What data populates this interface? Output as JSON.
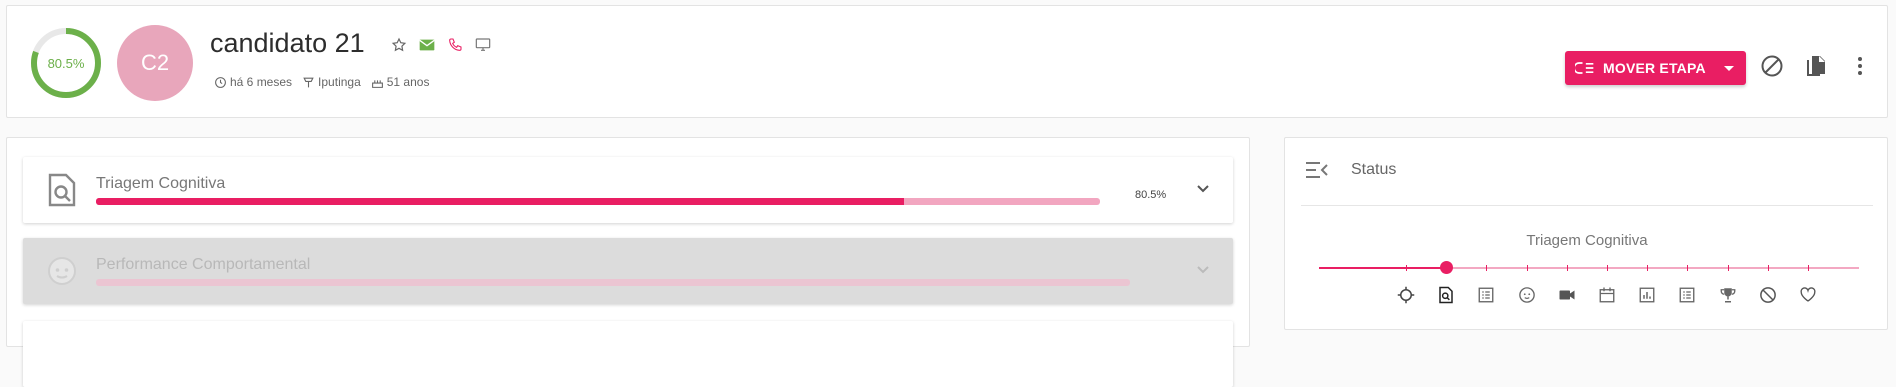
{
  "candidate": {
    "score": 80.5,
    "score_label": "80.5%",
    "initials": "C2",
    "name": "candidato 21",
    "meta": {
      "time": "há 6 meses",
      "location": "Iputinga",
      "age": "51 anos"
    }
  },
  "header": {
    "move_button_label": "MOVER ETAPA"
  },
  "stages": [
    {
      "title": "Triagem Cognitiva",
      "progress": 0.805,
      "pct_label": "80.5%"
    },
    {
      "title": "Performance Comportamental",
      "progress": 0
    }
  ],
  "status": {
    "title": "Status",
    "current_stage": "Triagem Cognitiva",
    "timeline_icons": [
      "target-icon",
      "search-document-icon",
      "list-icon",
      "face-icon",
      "video-icon",
      "calendar-icon",
      "chart-icon",
      "list-icon",
      "trophy-icon",
      "block-icon",
      "heart-icon"
    ],
    "current_index": 1
  },
  "colors": {
    "accent": "#e91e63",
    "accent_light": "#f2a6c0",
    "score_green": "#6cb04a",
    "avatar": "#e8a6bb"
  }
}
